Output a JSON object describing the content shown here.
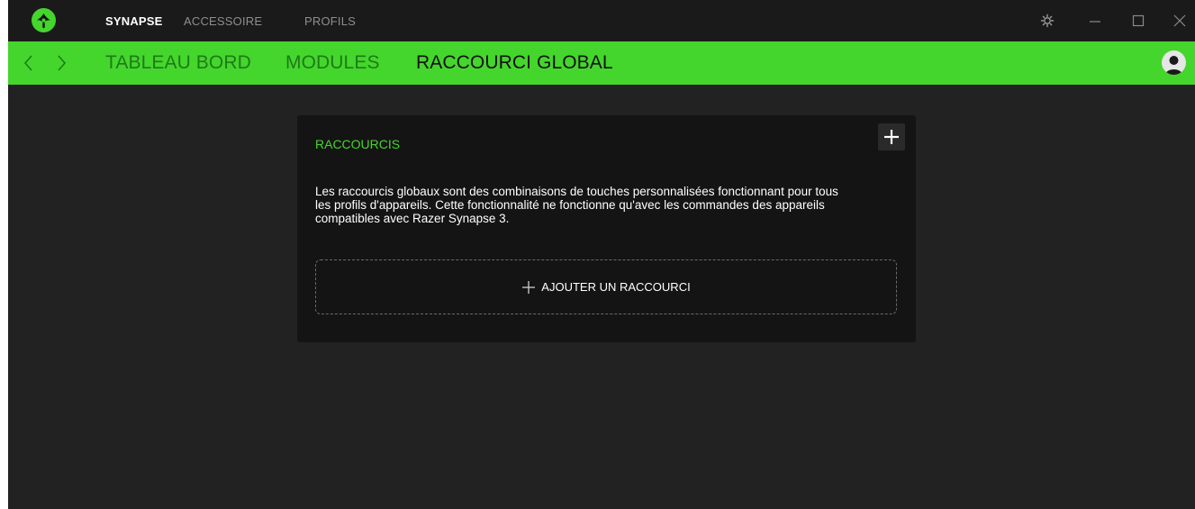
{
  "titlebar": {
    "tabs": [
      {
        "label": "SYNAPSE",
        "active": true
      },
      {
        "label": "ACCESSOIRE",
        "active": false
      },
      {
        "label": "PROFILS",
        "active": false
      }
    ]
  },
  "navbar": {
    "tabs": [
      {
        "label": "TABLEAU BORD",
        "active": false
      },
      {
        "label": "MODULES",
        "active": false
      },
      {
        "label": "RACCOURCI GLOBAL",
        "active": true
      }
    ]
  },
  "card": {
    "title": "RACCOURCIS",
    "description_lines": [
      "Les raccourcis globaux sont des combinaisons de touches personnalisées fonctionnant pour tous",
      "les profils d'appareils. Cette fonctionnalité ne fonctionne qu'avec les commandes des appareils",
      "compatibles avec Razer Synapse 3."
    ],
    "add_shortcut_label": "AJOUTER UN RACCOURCI"
  },
  "colors": {
    "accent": "#44d62c",
    "background": "#222222",
    "titlebar": "#1a1a1a",
    "card": "#141414"
  },
  "icons": [
    "razer-logo-icon",
    "settings-icon",
    "minimize-icon",
    "maximize-icon",
    "close-icon",
    "back-arrow-icon",
    "forward-arrow-icon",
    "user-avatar-icon",
    "plus-icon"
  ]
}
